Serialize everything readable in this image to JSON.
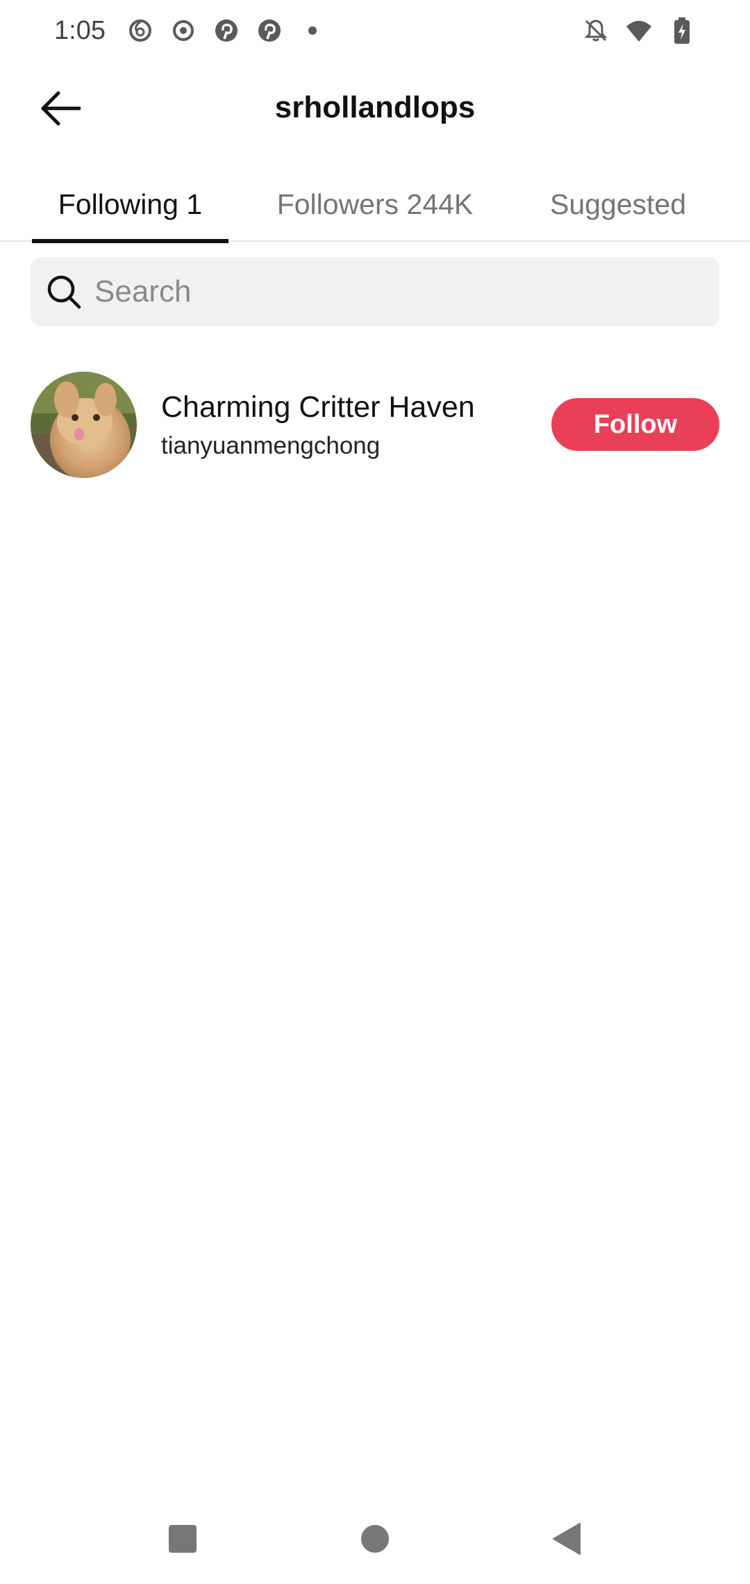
{
  "status_bar": {
    "time": "1:05",
    "left_icons": [
      "netease-music-icon",
      "record-icon",
      "pinterest-icon",
      "pinterest-icon",
      "dot-icon"
    ],
    "right_icons": [
      "bell-off-icon",
      "wifi-icon",
      "battery-charging-icon"
    ]
  },
  "header": {
    "title": "srhollandlops"
  },
  "tabs": [
    {
      "label": "Following 1",
      "active": true
    },
    {
      "label": "Followers 244K",
      "active": false
    },
    {
      "label": "Suggested",
      "active": false
    }
  ],
  "search": {
    "placeholder": "Search",
    "value": ""
  },
  "list": [
    {
      "name": "Charming Critter Haven",
      "handle": "tianyuanmengchong",
      "action_label": "Follow"
    }
  ],
  "colors": {
    "accent": "#ea3f58",
    "tab_active": "#111111",
    "tab_inactive": "#747474",
    "search_bg": "#f1f1f2"
  },
  "nav_bar": {
    "buttons": [
      "recents-icon",
      "home-icon",
      "back-triangle-icon"
    ]
  }
}
